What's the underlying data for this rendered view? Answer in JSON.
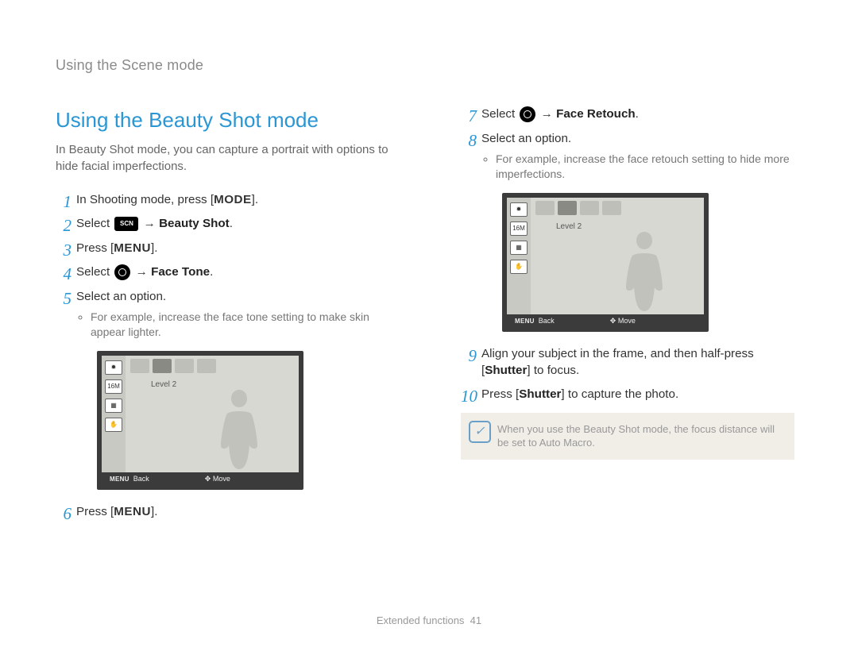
{
  "running_title": "Using the Scene mode",
  "heading": "Using the Beauty Shot mode",
  "intro": "In Beauty Shot mode, you can capture a portrait with options to hide facial imperfections.",
  "left_steps": {
    "s1_a": "In Shooting mode, press [",
    "s1_b": "MODE",
    "s1_c": "].",
    "s2_a": "Select ",
    "s2_icon": "SCN",
    "s2_b": " → ",
    "s2_bold": "Beauty Shot",
    "s2_c": ".",
    "s3_a": "Press [",
    "s3_b": "MENU",
    "s3_c": "].",
    "s4_a": "Select ",
    "s4_b": " → ",
    "s4_bold": "Face Tone",
    "s4_c": ".",
    "s5": "Select an option.",
    "s5_sub": "For example, increase the face tone setting to make skin appear lighter.",
    "s6_a": "Press [",
    "s6_b": "MENU",
    "s6_c": "]."
  },
  "right_steps": {
    "s7_a": "Select ",
    "s7_b": " → ",
    "s7_bold": "Face Retouch",
    "s7_c": ".",
    "s8": "Select an option.",
    "s8_sub": "For example, increase the face retouch setting to hide more imperfections.",
    "s9_a": "Align your subject in the frame, and then half-press [",
    "s9_b": "Shutter",
    "s9_c": "] to focus.",
    "s10_a": "Press [",
    "s10_b": "Shutter",
    "s10_c": "] to capture the photo."
  },
  "note_text": "When you use the Beauty Shot mode, the focus distance will be set to Auto Macro.",
  "screenshot": {
    "level_label": "Level 2",
    "menu_label": "MENU",
    "back_label": "Back",
    "move_label": "Move",
    "size_label": "16M"
  },
  "footer_a": "Extended functions",
  "footer_b": "41"
}
